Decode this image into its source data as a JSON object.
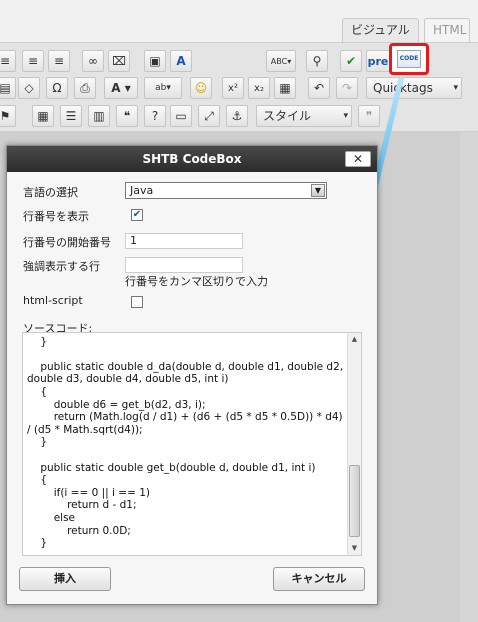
{
  "editor": {
    "tab_visual": "ビジュアル",
    "tab_html": "HTML",
    "toolbar": {
      "row1_buttons": [
        "align-left-icon",
        "align-center-icon",
        "align-right-icon",
        "link-icon",
        "unlink-icon",
        "insert-image-icon",
        "text-color-icon",
        "spellcheck-icon",
        "find-replace-icon",
        "check-icon"
      ],
      "pre_label": "pre",
      "code_label": "CODE",
      "quicktags_label": "Quicktags",
      "style_label": "スタイル"
    }
  },
  "dialog": {
    "title": "SHTB CodeBox",
    "close_label": "✕",
    "language_label": "言語の選択",
    "language_value": "Java",
    "line_numbers_label": "行番号を表示",
    "line_numbers_checked": true,
    "start_line_label": "行番号の開始番号",
    "start_line_value": "1",
    "highlight_label": "強調表示する行",
    "highlight_value": "",
    "highlight_hint": "行番号をカンマ区切りで入力",
    "html_script_label": "html-script",
    "html_script_checked": false,
    "source_label": "ソースコード:",
    "source_code": "        return result;\n    }\n\n    public static double d_da(double d, double d1, double d2, double d3, double d4, double d5, int i)\n    {\n        double d6 = get_b(d2, d3, i);\n        return (Math.log(d / d1) + (d6 + (d5 * d5 * 0.5D)) * d4) / (d5 * Math.sqrt(d4));\n    }\n\n    public static double get_b(double d, double d1, int i)\n    {\n        if(i == 0 || i == 1)\n            return d - d1;\n        else\n            return 0.0D;\n    }\n",
    "insert_button": "挿入",
    "cancel_button": "キャンセル"
  },
  "colors": {
    "highlight_box": "#e8191d",
    "arrow": "#29a9df"
  }
}
